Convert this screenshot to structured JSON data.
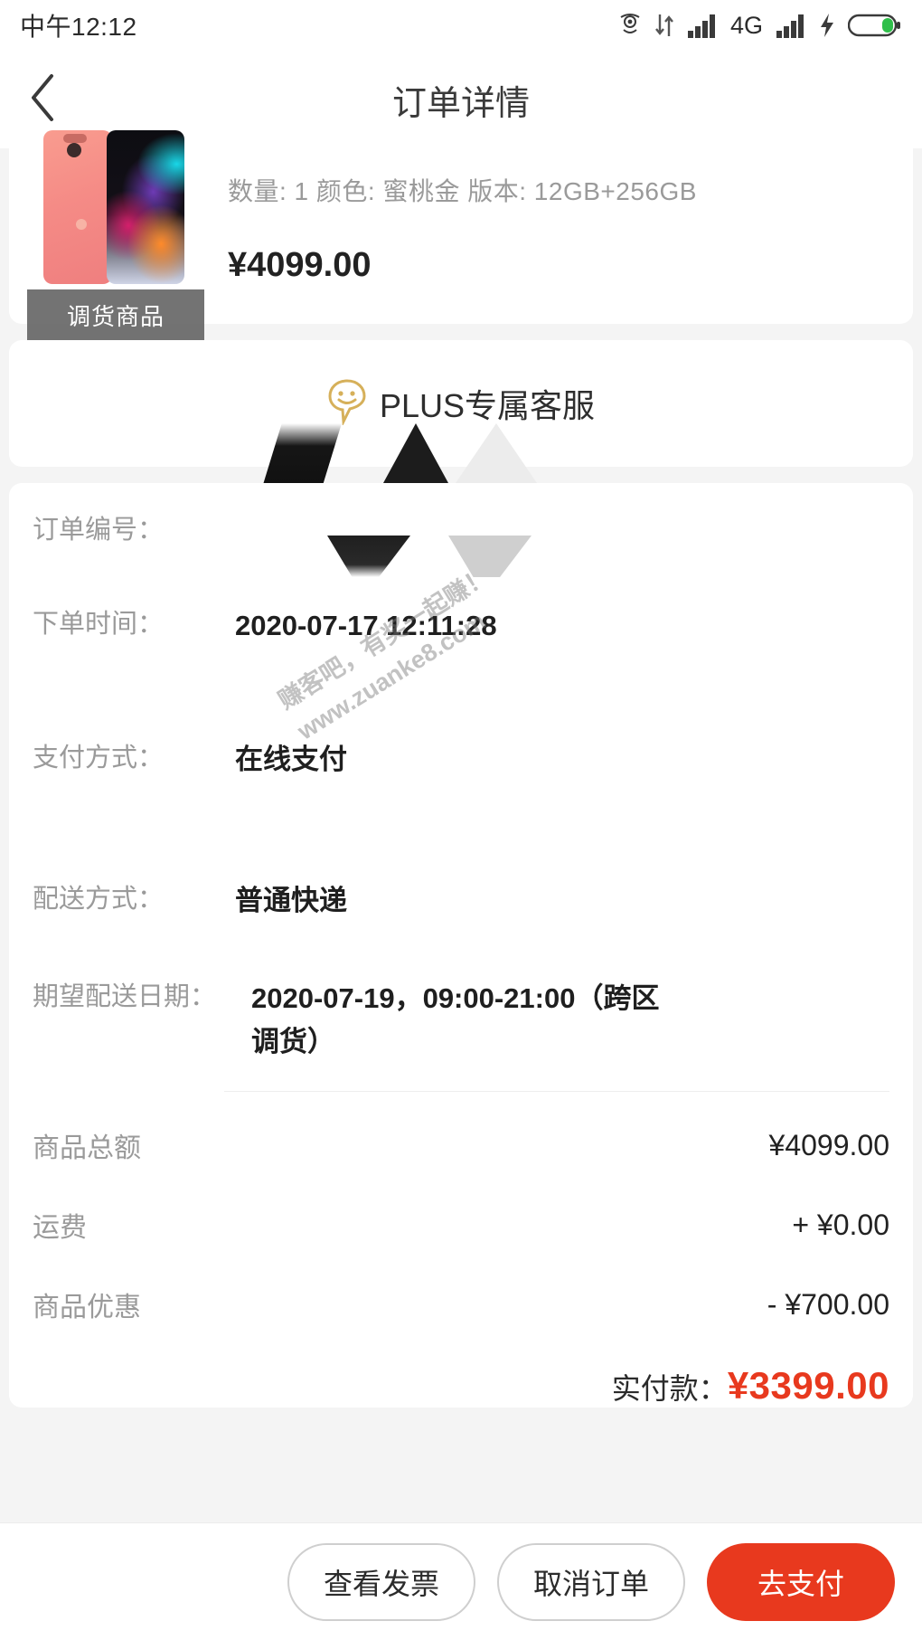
{
  "statusbar": {
    "time": "中午12:12",
    "icons": [
      "location-icon",
      "data-transfer-icon",
      "signal-bars-icon",
      "network-4g-label",
      "signal-bars-2-icon",
      "charging-bolt-icon",
      "battery-icon"
    ],
    "network": "4G"
  },
  "header": {
    "title": "订单详情",
    "back_icon": "chevron-left-icon"
  },
  "product": {
    "badge": "调货商品",
    "spec_line": "数量: 1  颜色: 蜜桃金  版本: 12GB+256GB",
    "quantity_label": "数量: 1",
    "color_label": "颜色: 蜜桃金",
    "version_label": "版本: 12GB+256GB",
    "price": "¥4099.00"
  },
  "plus_service": {
    "label": "PLUS专属客服",
    "icon": "smiley-chat-bubble-icon",
    "icon_color": "#d6b05a"
  },
  "order_info": [
    {
      "label": "订单编号：",
      "value": "",
      "redacted": true
    },
    {
      "label": "下单时间：",
      "value": "2020-07-17 12:11:28"
    },
    {
      "label": "支付方式：",
      "value": "在线支付"
    },
    {
      "label": "配送方式：",
      "value": "普通快递"
    },
    {
      "label": "期望配送日期：",
      "value": "2020-07-19，09:00-21:00（跨区调货）"
    }
  ],
  "totals": [
    {
      "label": "商品总额",
      "amount": "¥4099.00"
    },
    {
      "label": "运费",
      "amount": "+ ¥0.00"
    },
    {
      "label": "商品优惠",
      "amount": "- ¥700.00"
    }
  ],
  "final_payment": {
    "label": "实付款：",
    "amount": "¥3399.00",
    "color": "#e8391e"
  },
  "watermark": {
    "line1": "赚客吧，有奖一起赚！",
    "line2": "www.zuanke8.com"
  },
  "bottom_actions": {
    "view_invoice": "查看发票",
    "cancel_order": "取消订单",
    "pay_now": "去支付"
  }
}
